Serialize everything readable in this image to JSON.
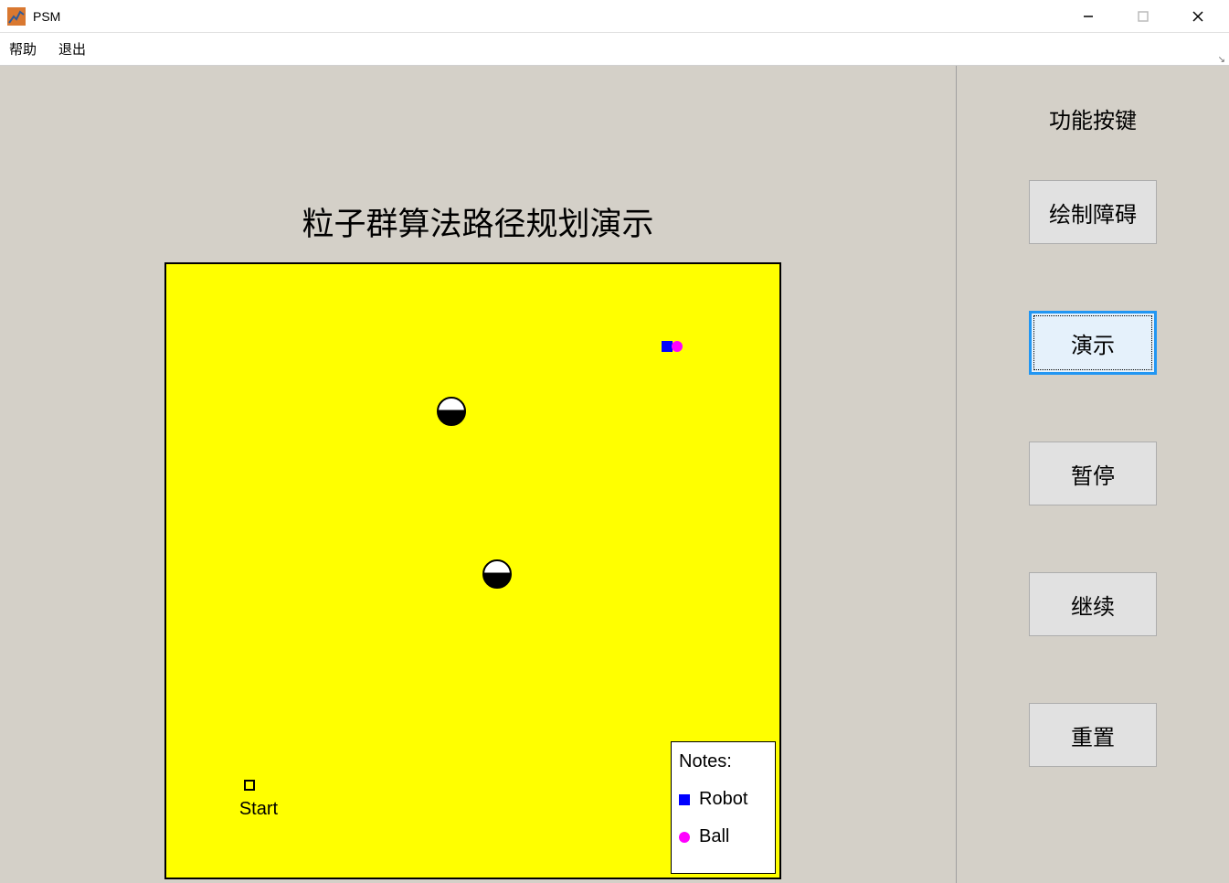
{
  "window": {
    "title": "PSM"
  },
  "menu": {
    "help": "帮助",
    "exit": "退出"
  },
  "plot": {
    "title": "粒子群算法路径规划演示",
    "start_label": "Start",
    "obstacles": [
      {
        "x_pct": 46.5,
        "y_pct": 24
      },
      {
        "x_pct": 54,
        "y_pct": 50.5
      }
    ],
    "robot": {
      "x_pct": 81.6,
      "y_pct": 13.4
    },
    "ball": {
      "x_pct": 83.3,
      "y_pct": 13.4
    },
    "start_marker": {
      "x_pct": 13.5,
      "y_pct": 85
    }
  },
  "legend": {
    "title": "Notes:",
    "robot": "Robot",
    "ball": "Ball"
  },
  "sidebar": {
    "title": "功能按键",
    "buttons": {
      "draw": "绘制障碍",
      "demo": "演示",
      "pause": "暂停",
      "resume": "继续",
      "reset": "重置"
    }
  }
}
